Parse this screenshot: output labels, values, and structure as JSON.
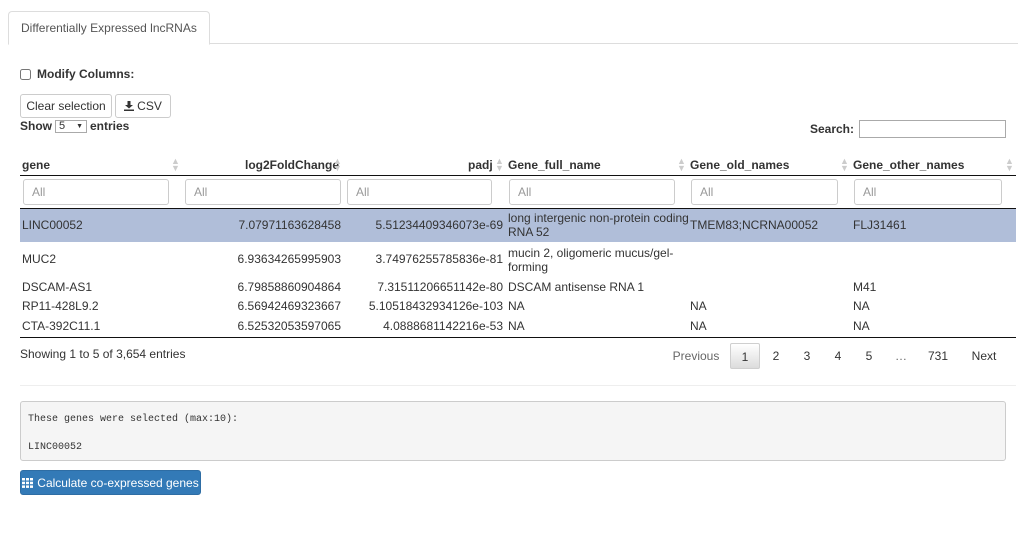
{
  "tabs": [
    {
      "label": "Differentially Expressed lncRNAs"
    }
  ],
  "controls": {
    "modify_columns_label": "Modify Columns:",
    "clear_selection_label": "Clear selection",
    "csv_label": "CSV",
    "show_prefix": "Show",
    "show_value": "5",
    "show_suffix": "entries",
    "search_label": "Search:"
  },
  "table": {
    "columns": [
      "gene",
      "log2FoldChange",
      "padj",
      "Gene_full_name",
      "Gene_old_names",
      "Gene_other_names"
    ],
    "filter_placeholder": "All",
    "rows": [
      {
        "gene": "LINC00052",
        "log2FoldChange": "7.07971163628458",
        "padj": "5.51234409346073e-69",
        "full1": "long intergenic non-protein coding",
        "full2": "RNA 52",
        "old": "TMEM83;NCRNA00052",
        "other": "FLJ31461",
        "selected": true
      },
      {
        "gene": "MUC2",
        "log2FoldChange": "6.93634265995903",
        "padj": "3.74976255785836e-81",
        "full1": "mucin 2, oligomeric mucus/gel-",
        "full2": "forming",
        "old": "",
        "other": "",
        "selected": false
      },
      {
        "gene": "DSCAM-AS1",
        "log2FoldChange": "6.79858860904864",
        "padj": "7.31511206651142e-80",
        "full1": "DSCAM antisense RNA 1",
        "full2": "",
        "old": "",
        "other": "M41",
        "selected": false
      },
      {
        "gene": "RP11-428L9.2",
        "log2FoldChange": "6.56942469323667",
        "padj": "5.10518432934126e-103",
        "full1": "NA",
        "full2": "",
        "old": "NA",
        "other": "NA",
        "selected": false
      },
      {
        "gene": "CTA-392C11.1",
        "log2FoldChange": "6.52532053597065",
        "padj": "4.0888681142216e-53",
        "full1": "NA",
        "full2": "",
        "old": "NA",
        "other": "NA",
        "selected": false
      }
    ]
  },
  "info": "Showing 1 to 5 of 3,654 entries",
  "pagination": {
    "previous": "Previous",
    "pages": [
      "1",
      "2",
      "3",
      "4",
      "5",
      "…",
      "731"
    ],
    "next": "Next",
    "current": "1"
  },
  "selection_box": {
    "line1": "These genes were selected (max:10):",
    "line2": "LINC00052"
  },
  "calc_button_label": "Calculate co-expressed genes",
  "colors": {
    "selected_row": "#b0bed9",
    "primary": "#337ab7"
  }
}
